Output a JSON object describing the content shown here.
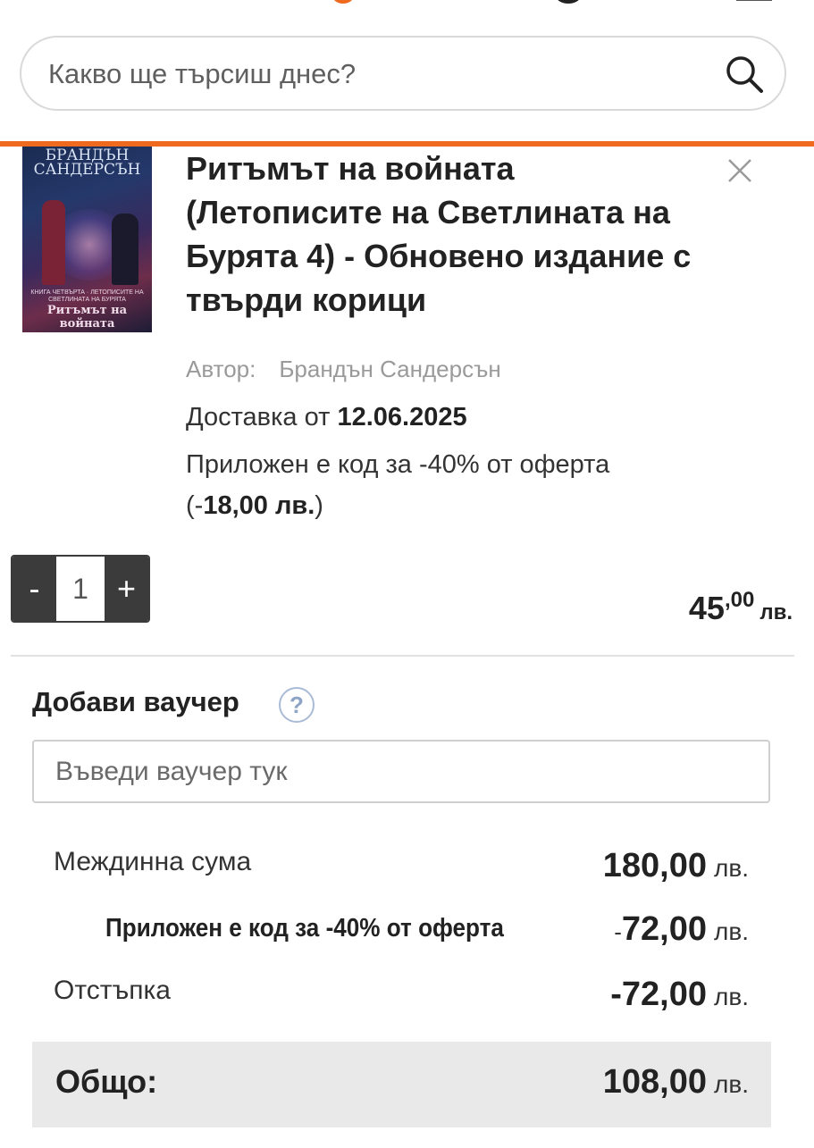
{
  "search": {
    "placeholder": "Какво ще търсиш днес?"
  },
  "product": {
    "cover": {
      "author": "БРАНДЪН САНДЕРСЪН",
      "series": "КНИГА ЧЕТВЪРТА · ЛЕТОПИСИТЕ НА СВЕТЛИНАТА НА БУРЯТА",
      "title": "Ритъмът на войната"
    },
    "title": "Ритъмът на войната (Летописите на Светлината на Бурята 4) - Обновено издание с твърди корици",
    "author_label": "Автор:",
    "author_name": "Брандън Сандерсън",
    "delivery_prefix": "Доставка от",
    "delivery_date": "12.06.2025",
    "promo_text": "Приложен е код за -40% от оферта",
    "promo_open": "(-",
    "promo_amount": "18,00 лв.",
    "promo_close": ")",
    "quantity": "1",
    "minus_label": "-",
    "plus_label": "+",
    "price_int": "45",
    "price_dec": ",00",
    "price_currency": "лв."
  },
  "voucher": {
    "label": "Добави ваучер",
    "help_glyph": "?",
    "placeholder": "Въведи ваучер тук"
  },
  "summary": {
    "subtotal_label": "Междинна сума",
    "subtotal_amount": "180,00",
    "code_label": "Приложен е код за -40% от оферта",
    "code_sign": "-",
    "code_amount": "72,00",
    "discount_label": "Отстъпка",
    "discount_amount": "-72,00",
    "total_label": "Общо:",
    "total_amount": "108,00",
    "currency": "лв."
  },
  "colors": {
    "accent": "#ef6a1f",
    "stepper": "#3b3b3b",
    "total_bg": "#e9e9e9"
  }
}
